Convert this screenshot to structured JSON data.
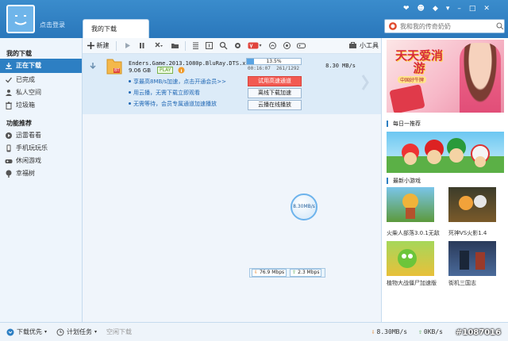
{
  "header": {
    "login_text": "点击登录",
    "tab_label": "我的下载",
    "search_placeholder": "我和我的传奇奶奶",
    "window_controls": [
      "❤",
      "☻",
      "◆",
      "▾",
      "–",
      "□",
      "✕"
    ]
  },
  "sidebar": {
    "section1": "我的下载",
    "items": [
      {
        "label": "正在下载",
        "icon": "download-icon",
        "active": true
      },
      {
        "label": "已完成",
        "icon": "check-icon"
      },
      {
        "label": "私人空间",
        "icon": "person-icon"
      },
      {
        "label": "垃圾箱",
        "icon": "trash-icon"
      }
    ],
    "section2": "功能推荐",
    "items2": [
      {
        "label": "迅雷看看",
        "icon": "video-icon"
      },
      {
        "label": "手机玩玩乐",
        "icon": "phone-icon"
      },
      {
        "label": "休闲游戏",
        "icon": "gamepad-icon"
      },
      {
        "label": "幸福树",
        "icon": "tree-icon"
      }
    ]
  },
  "toolbar": {
    "new_label": "新建",
    "tools_label": "小工具"
  },
  "task": {
    "file_name": "Enders.Game.2013.1080p.BluRay.DTS.x...",
    "file_size": "9.06 GB",
    "play_badge": "PLAY",
    "file_badge": "BT",
    "progress_text": "13.5%",
    "progress": 0.135,
    "elapsed": "00:16:07",
    "remaining": "261/1292",
    "speed": "8.30   MB/s",
    "links": [
      "享最高8MB/s加速，点击开通会员>>",
      "用云播，无需下载立即观看",
      "无需等待，会员专属通道加速播放"
    ],
    "buttons": [
      "试用高速通道",
      "离线下载加速",
      "云播在线播放"
    ]
  },
  "floating": {
    "speed_ball": "8.30MB/s",
    "down_rate": "76.9 Mbps",
    "up_rate": "2.3 Mbps"
  },
  "right": {
    "banner_title": "天天爱消游",
    "banner_sub": "中国好牛牌",
    "daily_label": "每日一推荐",
    "games_label": "最新小游戏",
    "games": [
      {
        "name": "火柴人部落3.0.1无敌"
      },
      {
        "name": "死神VS火影1.4"
      },
      {
        "name": "植物大战僵尸加速版"
      },
      {
        "name": "街机三国志"
      }
    ]
  },
  "status": {
    "first_label": "下载优先",
    "plan_label": "计划任务",
    "idle_label": "空闲下载",
    "down": "8.30MB/s",
    "up": "0KB/s"
  },
  "watermark": "#1087016",
  "colors": {
    "titlebar": "#2a77bb",
    "accent": "#2d7fc3",
    "red_button": "#f25a52"
  }
}
